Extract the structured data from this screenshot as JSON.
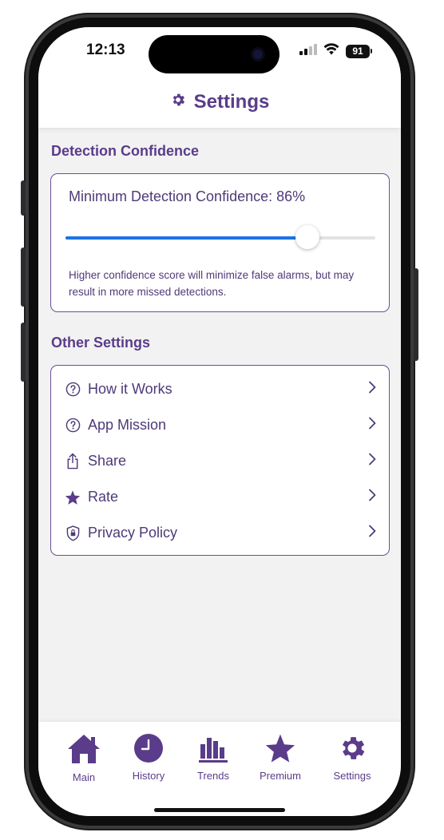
{
  "status_bar": {
    "time": "12:13",
    "battery": "91"
  },
  "header": {
    "title": "Settings",
    "icon": "gear-icon"
  },
  "detection": {
    "section_title": "Detection Confidence",
    "slider_label": "Minimum Detection Confidence: 86%",
    "slider_value": 0.78,
    "hint": "Higher confidence score will minimize false alarms, but may result in more missed detections."
  },
  "other_settings": {
    "section_title": "Other Settings",
    "items": [
      {
        "label": "How it Works",
        "icon": "question-circle-icon"
      },
      {
        "label": "App Mission",
        "icon": "question-circle-icon"
      },
      {
        "label": "Share",
        "icon": "share-icon"
      },
      {
        "label": "Rate",
        "icon": "star-icon"
      },
      {
        "label": "Privacy Policy",
        "icon": "shield-lock-icon"
      }
    ]
  },
  "tabbar": {
    "tabs": [
      {
        "label": "Main",
        "icon": "home-icon"
      },
      {
        "label": "History",
        "icon": "clock-icon"
      },
      {
        "label": "Trends",
        "icon": "bar-chart-icon"
      },
      {
        "label": "Premium",
        "icon": "star-icon"
      },
      {
        "label": "Settings",
        "icon": "gear-icon"
      }
    ]
  },
  "colors": {
    "accent": "#5a3c8a",
    "slider": "#1a73e8",
    "background": "#f2f2f2"
  }
}
